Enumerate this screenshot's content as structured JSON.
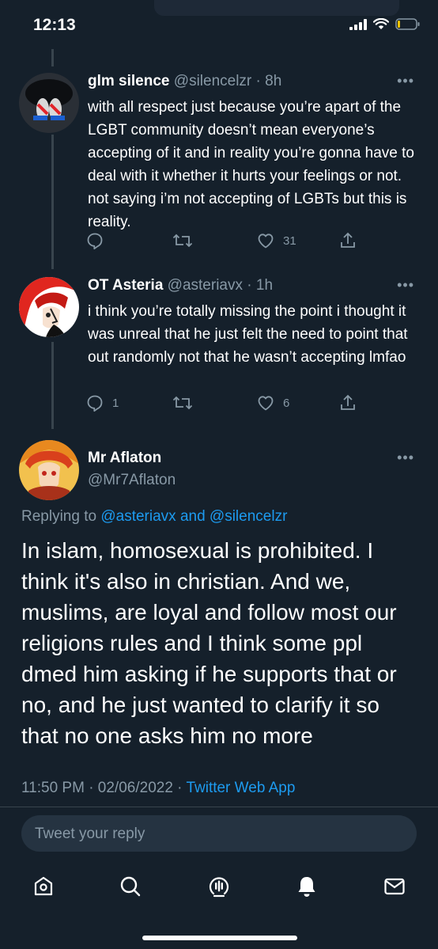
{
  "status_bar": {
    "time": "12:13"
  },
  "tweets": [
    {
      "name": "glm silence",
      "handle": "@silencelzr",
      "time": "8h",
      "text": "with all respect just because you’re apart of the LGBT community doesn’t mean everyone’s accepting of it and in reality you’re gonna have to deal with it whether it hurts your feelings or not. not saying i’m not accepting of LGBTs but this is reality.",
      "replies": "",
      "retweets": "",
      "likes": "31"
    },
    {
      "name": "OT Asteria",
      "handle": "@asteriavx",
      "time": "1h",
      "text": "i think you’re totally missing the point i thought it was unreal that he just felt the need to point that out randomly not that he wasn’t accepting lmfao",
      "replies": "1",
      "retweets": "",
      "likes": "6"
    }
  ],
  "main_tweet": {
    "name": "Mr Aflaton",
    "handle": "@Mr7Aflaton",
    "replying_prefix": "Replying to",
    "replying_mentions": "@asteriavx and @silencelzr",
    "text": "In islam, homosexual is prohibited. I think it's also in christian. And we, muslims, are loyal and follow most our religions rules and I think some ppl dmed him asking if he supports that or no, and he just wanted to clarify it so that no one asks him no more",
    "timestamp": "11:50 PM · 02/06/2022 · ",
    "source": "Twitter Web App"
  },
  "reply_box": {
    "placeholder": "Tweet your reply"
  },
  "tabbar": {
    "icons": [
      "home-icon",
      "search-icon",
      "spaces-icon",
      "notifications-icon",
      "messages-icon"
    ]
  },
  "colors": {
    "background": "#15202b",
    "accent": "#1d9bf0",
    "muted": "#8899a6",
    "input": "#253341"
  }
}
